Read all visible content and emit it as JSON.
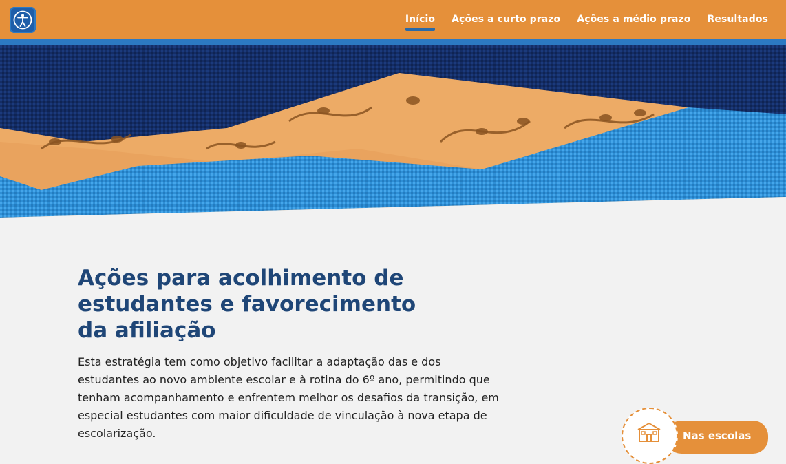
{
  "header": {
    "logo_icon": "accessibility-person-icon",
    "nav": [
      {
        "label": "Início",
        "active": true
      },
      {
        "label": "Ações a curto prazo",
        "active": false
      },
      {
        "label": "Ações a médio prazo",
        "active": false
      },
      {
        "label": "Resultados",
        "active": false
      }
    ]
  },
  "colors": {
    "header_bg": "#e5903a",
    "stripe_blue": "#2c79c2",
    "navy": "#132c63",
    "title_blue": "#1f4677"
  },
  "main": {
    "title_lines": [
      "Ações para acolhimento de",
      "estudantes e favorecimento",
      "da afiliação"
    ],
    "description": "Esta estratégia tem como objetivo facilitar a adaptação das e dos estudantes ao novo ambiente escolar e à rotina do 6º ano, permitindo que tenham acompanhamento e enfrentem melhor os desafios da transição, em especial estudantes com maior dificuldade de vinculação à nova etapa de escolarização."
  },
  "floating": {
    "button_label": "Nas escolas",
    "icon": "school-building-icon"
  }
}
